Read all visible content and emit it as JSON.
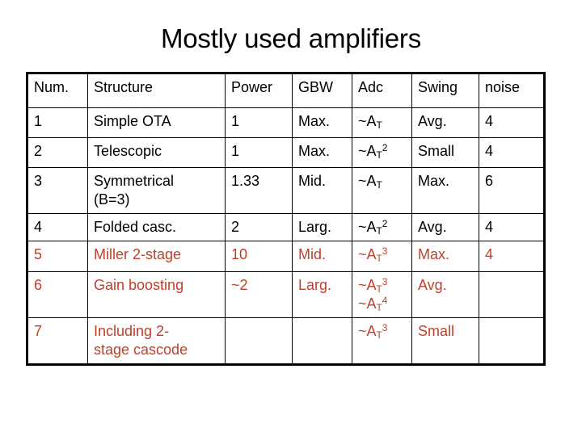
{
  "slide": {
    "title": "Mostly used amplifiers",
    "title_color": "#000000",
    "background_color": "#ffffff",
    "accent_color": "#C0402A"
  },
  "table": {
    "columns": [
      "Num.",
      "Structure",
      "Power",
      "GBW",
      "Adc",
      "Swing",
      "noise"
    ],
    "rows": [
      {
        "color": "#000000",
        "num": "1",
        "structure": [
          "Simple OTA"
        ],
        "power": "1",
        "gbw": "Max.",
        "adc": [
          {
            "base": "~A",
            "sub": "T",
            "sup": ""
          }
        ],
        "swing": "Avg.",
        "noise": "4"
      },
      {
        "color": "#000000",
        "num": "2",
        "structure": [
          "Telescopic"
        ],
        "power": "1",
        "gbw": "Max.",
        "adc": [
          {
            "base": "~A",
            "sub": "T",
            "sup": "2"
          }
        ],
        "swing": "Small",
        "noise": "4"
      },
      {
        "color": "#000000",
        "num": "3",
        "structure": [
          "Symmetrical",
          "(B=3)"
        ],
        "power": "1.33",
        "gbw": "Mid.",
        "adc": [
          {
            "base": "~A",
            "sub": "T",
            "sup": ""
          }
        ],
        "swing": "Max.",
        "noise": "6"
      },
      {
        "color": "#000000",
        "num": "4",
        "structure": [
          "Folded casc."
        ],
        "power": "2",
        "gbw": "Larg.",
        "adc": [
          {
            "base": "~A",
            "sub": "T",
            "sup": "2"
          }
        ],
        "swing": "Avg.",
        "noise": "4"
      },
      {
        "color": "#C0402A",
        "num": "5",
        "structure": [
          "Miller 2-stage"
        ],
        "power": "10",
        "gbw": "Mid.",
        "adc": [
          {
            "base": "~A",
            "sub": "T",
            "sup": "3"
          }
        ],
        "swing": "Max.",
        "noise": "4"
      },
      {
        "color": "#C0402A",
        "num": "6",
        "structure": [
          "Gain boosting"
        ],
        "power": "~2",
        "gbw": "Larg.",
        "adc": [
          {
            "base": "~A",
            "sub": "T",
            "sup": "3"
          },
          {
            "base": "~A",
            "sub": "T",
            "sup": "4"
          }
        ],
        "swing": "Avg.",
        "noise": ""
      },
      {
        "color": "#C0402A",
        "num": "7",
        "structure": [
          "Including 2-",
          "stage cascode"
        ],
        "power": "",
        "gbw": "",
        "adc": [
          {
            "base": "~A",
            "sub": "T",
            "sup": "3"
          }
        ],
        "swing": "Small",
        "noise": ""
      }
    ]
  }
}
